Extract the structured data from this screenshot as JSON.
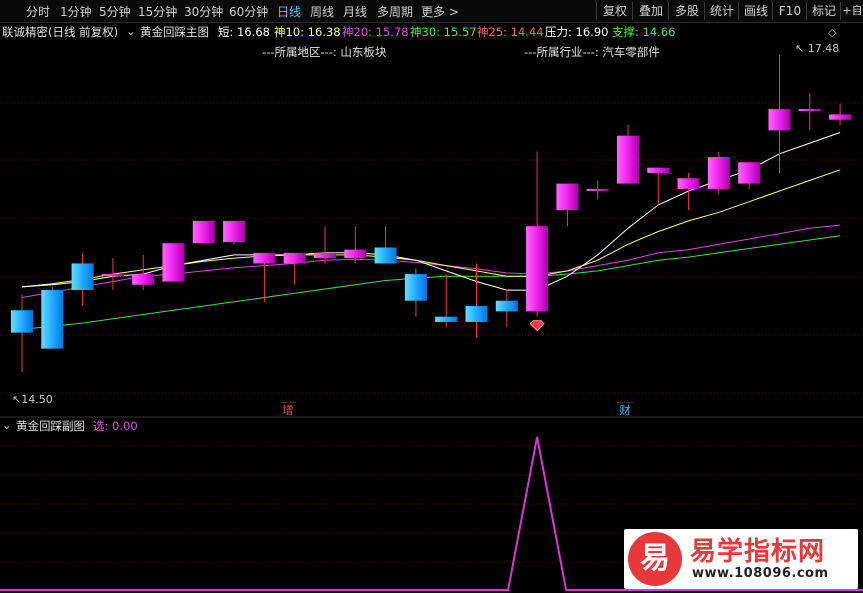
{
  "toolbar": {
    "periods": [
      "分时",
      "1分钟",
      "5分钟",
      "15分钟",
      "30分钟",
      "60分钟",
      "日线",
      "周线",
      "月线",
      "多周期",
      "更多 >"
    ],
    "active_period": "日线",
    "actions": [
      "复权",
      "叠加",
      "多股",
      "统计",
      "画线",
      "F10",
      "标记",
      "+自"
    ]
  },
  "info": {
    "stock": "联诚精密(日线 前复权)",
    "indicator": "黄金回踩主图",
    "short": "短: 16.68",
    "ma10": "神10: 16.38",
    "ma20": "神20: 15.78",
    "ma30": "神30: 15.57",
    "ma25": "神25: 14.44",
    "pressure": "压力: 16.90",
    "support": "支撑: 14.66"
  },
  "region": {
    "area": "---所属地区---: 山东板块",
    "industry": "---所属行业---: 汽车零部件"
  },
  "price_labels": {
    "high": "17.48",
    "low": "14.50"
  },
  "markers": {
    "zeng": "增",
    "cai": "财"
  },
  "sub": {
    "name": "黄金回踩副图",
    "value": "选: 0.00"
  },
  "logo": {
    "char": "易",
    "title": "易学指标网",
    "url": "www.108096.com"
  },
  "colors": {
    "up": "#ff33ff",
    "down": "#33bbff",
    "ma_white": "#ffffff",
    "ma_yellow": "#ffff66",
    "ma_magenta": "#dd44dd",
    "ma_green": "#44dd44",
    "signal": "#dd33dd",
    "grid": "#6a0000"
  },
  "candles": [
    {
      "o": 15.08,
      "h": 15.23,
      "l": 14.5,
      "c": 14.87
    },
    {
      "o": 15.27,
      "h": 15.3,
      "l": 14.72,
      "c": 14.72
    },
    {
      "o": 15.52,
      "h": 15.62,
      "l": 15.12,
      "c": 15.27
    },
    {
      "o": 15.42,
      "h": 15.57,
      "l": 15.27,
      "c": 15.42
    },
    {
      "o": 15.32,
      "h": 15.6,
      "l": 15.27,
      "c": 15.42
    },
    {
      "o": 15.35,
      "h": 15.71,
      "l": 15.35,
      "c": 15.71
    },
    {
      "o": 15.71,
      "h": 15.92,
      "l": 15.71,
      "c": 15.92
    },
    {
      "o": 15.72,
      "h": 15.92,
      "l": 15.7,
      "c": 15.92
    },
    {
      "o": 15.52,
      "h": 15.57,
      "l": 15.16,
      "c": 15.62
    },
    {
      "o": 15.52,
      "h": 15.62,
      "l": 15.32,
      "c": 15.62
    },
    {
      "o": 15.57,
      "h": 15.87,
      "l": 15.52,
      "c": 15.62
    },
    {
      "o": 15.57,
      "h": 15.87,
      "l": 15.52,
      "c": 15.65
    },
    {
      "o": 15.67,
      "h": 15.87,
      "l": 15.52,
      "c": 15.52
    },
    {
      "o": 15.42,
      "h": 15.47,
      "l": 15.02,
      "c": 15.17
    },
    {
      "o": 15.02,
      "h": 15.42,
      "l": 14.92,
      "c": 14.97
    },
    {
      "o": 15.12,
      "h": 15.52,
      "l": 14.82,
      "c": 14.97
    },
    {
      "o": 15.17,
      "h": 15.27,
      "l": 14.92,
      "c": 15.07
    },
    {
      "o": 15.07,
      "h": 16.57,
      "l": 15.02,
      "c": 15.87
    },
    {
      "o": 16.02,
      "h": 16.27,
      "l": 15.87,
      "c": 16.27
    },
    {
      "o": 16.22,
      "h": 16.3,
      "l": 16.12,
      "c": 16.22
    },
    {
      "o": 16.27,
      "h": 16.82,
      "l": 16.27,
      "c": 16.72
    },
    {
      "o": 16.37,
      "h": 16.42,
      "l": 16.07,
      "c": 16.42
    },
    {
      "o": 16.22,
      "h": 16.37,
      "l": 16.02,
      "c": 16.32
    },
    {
      "o": 16.22,
      "h": 16.57,
      "l": 16.17,
      "c": 16.52
    },
    {
      "o": 16.27,
      "h": 16.47,
      "l": 16.22,
      "c": 16.47
    },
    {
      "o": 16.77,
      "h": 17.48,
      "l": 16.37,
      "c": 16.97
    },
    {
      "o": 16.97,
      "h": 17.12,
      "l": 16.77,
      "c": 16.97
    },
    {
      "o": 16.87,
      "h": 17.02,
      "l": 16.82,
      "c": 16.92
    }
  ],
  "ma_white": [
    15.3,
    15.32,
    15.35,
    15.4,
    15.42,
    15.5,
    15.55,
    15.6,
    15.6,
    15.6,
    15.62,
    15.62,
    15.6,
    15.55,
    15.45,
    15.35,
    15.27,
    15.27,
    15.4,
    15.6,
    15.85,
    16.07,
    16.2,
    16.3,
    16.4,
    16.55,
    16.65,
    16.75
  ],
  "ma_yellow": [
    15.3,
    15.33,
    15.37,
    15.42,
    15.46,
    15.5,
    15.54,
    15.57,
    15.59,
    15.6,
    15.6,
    15.6,
    15.58,
    15.55,
    15.5,
    15.45,
    15.4,
    15.4,
    15.45,
    15.55,
    15.7,
    15.82,
    15.92,
    16.0,
    16.1,
    16.2,
    16.3,
    16.4
  ],
  "ma_magenta": [
    15.2,
    15.25,
    15.3,
    15.35,
    15.4,
    15.42,
    15.45,
    15.48,
    15.5,
    15.52,
    15.55,
    15.56,
    15.55,
    15.53,
    15.5,
    15.47,
    15.43,
    15.42,
    15.45,
    15.5,
    15.55,
    15.62,
    15.65,
    15.7,
    15.75,
    15.8,
    15.85,
    15.88
  ],
  "ma_green": [
    14.9,
    14.93,
    14.96,
    15.0,
    15.04,
    15.08,
    15.12,
    15.16,
    15.2,
    15.24,
    15.28,
    15.32,
    15.36,
    15.38,
    15.4,
    15.4,
    15.4,
    15.4,
    15.42,
    15.45,
    15.5,
    15.55,
    15.58,
    15.62,
    15.66,
    15.7,
    15.74,
    15.78
  ],
  "signal_peak_index": 17,
  "price_range": [
    14.35,
    17.6
  ]
}
